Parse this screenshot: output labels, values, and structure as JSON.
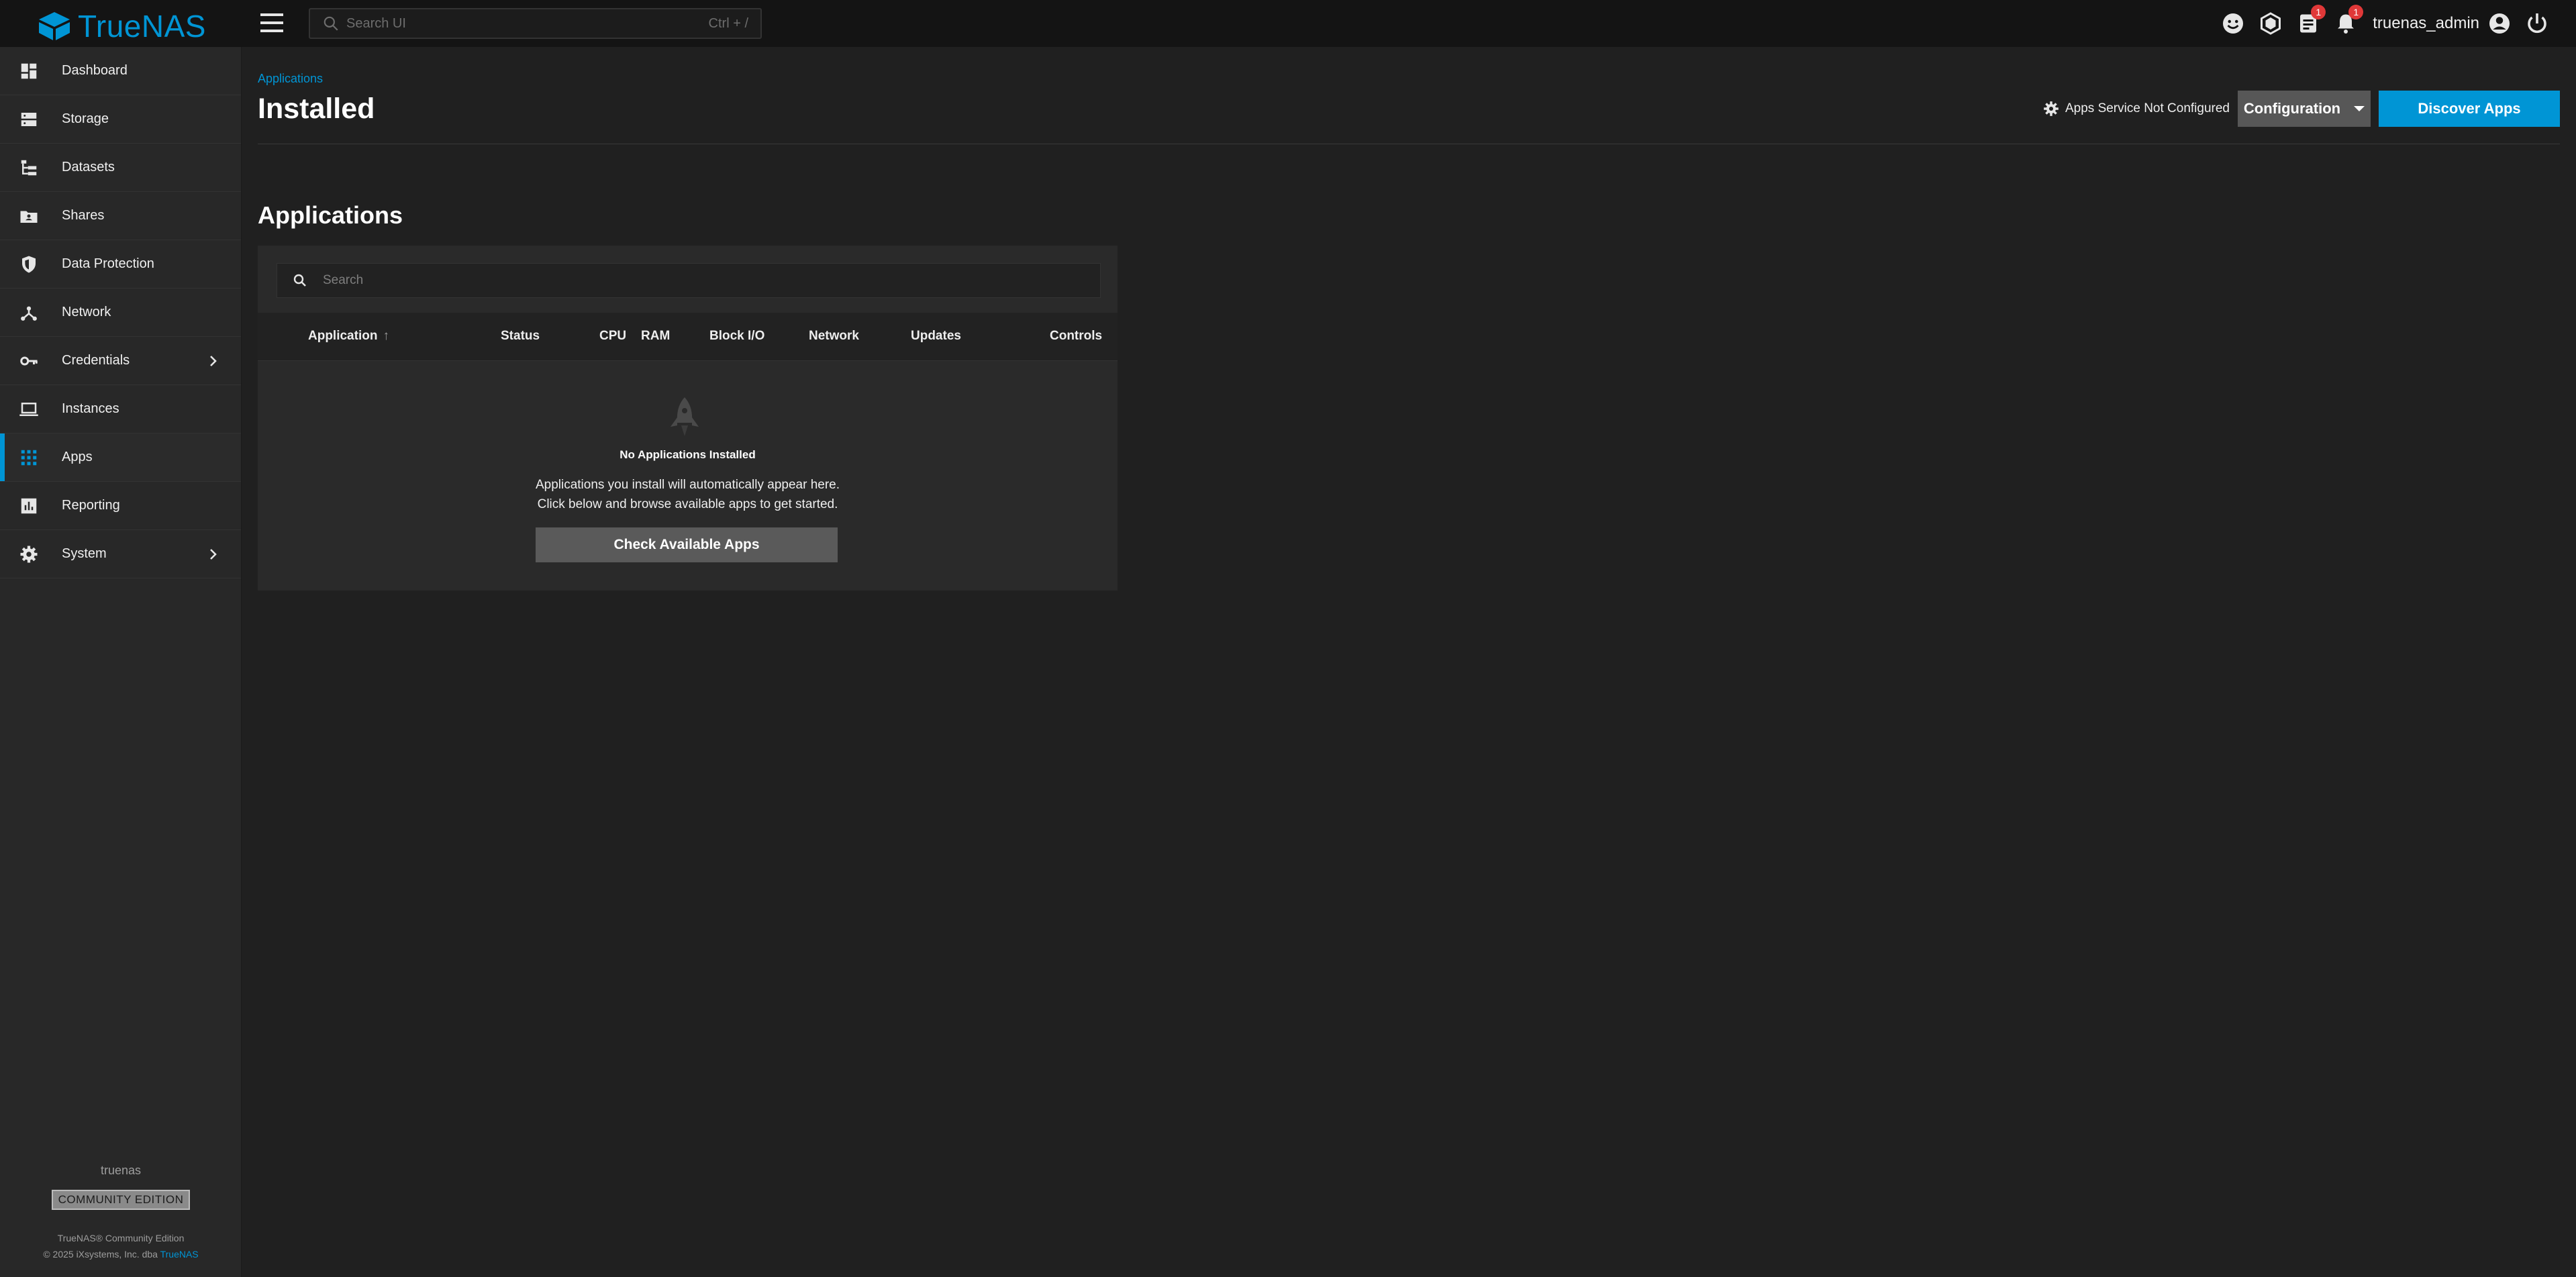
{
  "brand": {
    "name": "TrueNAS",
    "color": "#0095d5"
  },
  "topbar": {
    "menu_icon": "hamburger-menu-icon",
    "search": {
      "placeholder": "Search UI",
      "shortcut": "Ctrl + /"
    },
    "icons": [
      {
        "name": "feedback-icon"
      },
      {
        "name": "truecommand-icon"
      },
      {
        "name": "jobs-icon",
        "badge": "1"
      },
      {
        "name": "notifications-icon",
        "badge": "1"
      }
    ],
    "username": "truenas_admin",
    "account_icon": "account-circle-icon",
    "power_icon": "power-icon",
    "badge_color": "#e03838"
  },
  "sidebar": {
    "items": [
      {
        "label": "Dashboard",
        "icon": "dashboard-icon"
      },
      {
        "label": "Storage",
        "icon": "storage-icon"
      },
      {
        "label": "Datasets",
        "icon": "datasets-icon"
      },
      {
        "label": "Shares",
        "icon": "shares-icon"
      },
      {
        "label": "Data Protection",
        "icon": "data-protection-icon"
      },
      {
        "label": "Network",
        "icon": "network-icon"
      },
      {
        "label": "Credentials",
        "icon": "credentials-icon",
        "expandable": true
      },
      {
        "label": "Instances",
        "icon": "instances-icon"
      },
      {
        "label": "Apps",
        "icon": "apps-icon",
        "active": true
      },
      {
        "label": "Reporting",
        "icon": "reporting-icon"
      },
      {
        "label": "System",
        "icon": "system-icon",
        "expandable": true
      }
    ],
    "footer": {
      "hostname": "truenas",
      "edition": "COMMUNITY EDITION",
      "product_line": "TrueNAS® Community Edition",
      "copyright_prefix": "© 2025 iXsystems, Inc. dba ",
      "copyright_link": "TrueNAS"
    }
  },
  "page": {
    "breadcrumb": "Applications",
    "title": "Installed",
    "service_status": "Apps Service Not Configured",
    "configuration_label": "Configuration",
    "discover_label": "Discover Apps"
  },
  "apps": {
    "section_title": "Applications",
    "search_placeholder": "Search",
    "columns": [
      "Application",
      "Status",
      "CPU",
      "RAM",
      "Block I/O",
      "Network",
      "Updates",
      "Controls"
    ],
    "sort_column": "Application",
    "sort_direction": "ascending",
    "empty": {
      "title": "No Applications Installed",
      "line1": "Applications you install will automatically appear here.",
      "line2": "Click below and browse available apps to get started.",
      "button_label": "Check Available Apps"
    }
  }
}
